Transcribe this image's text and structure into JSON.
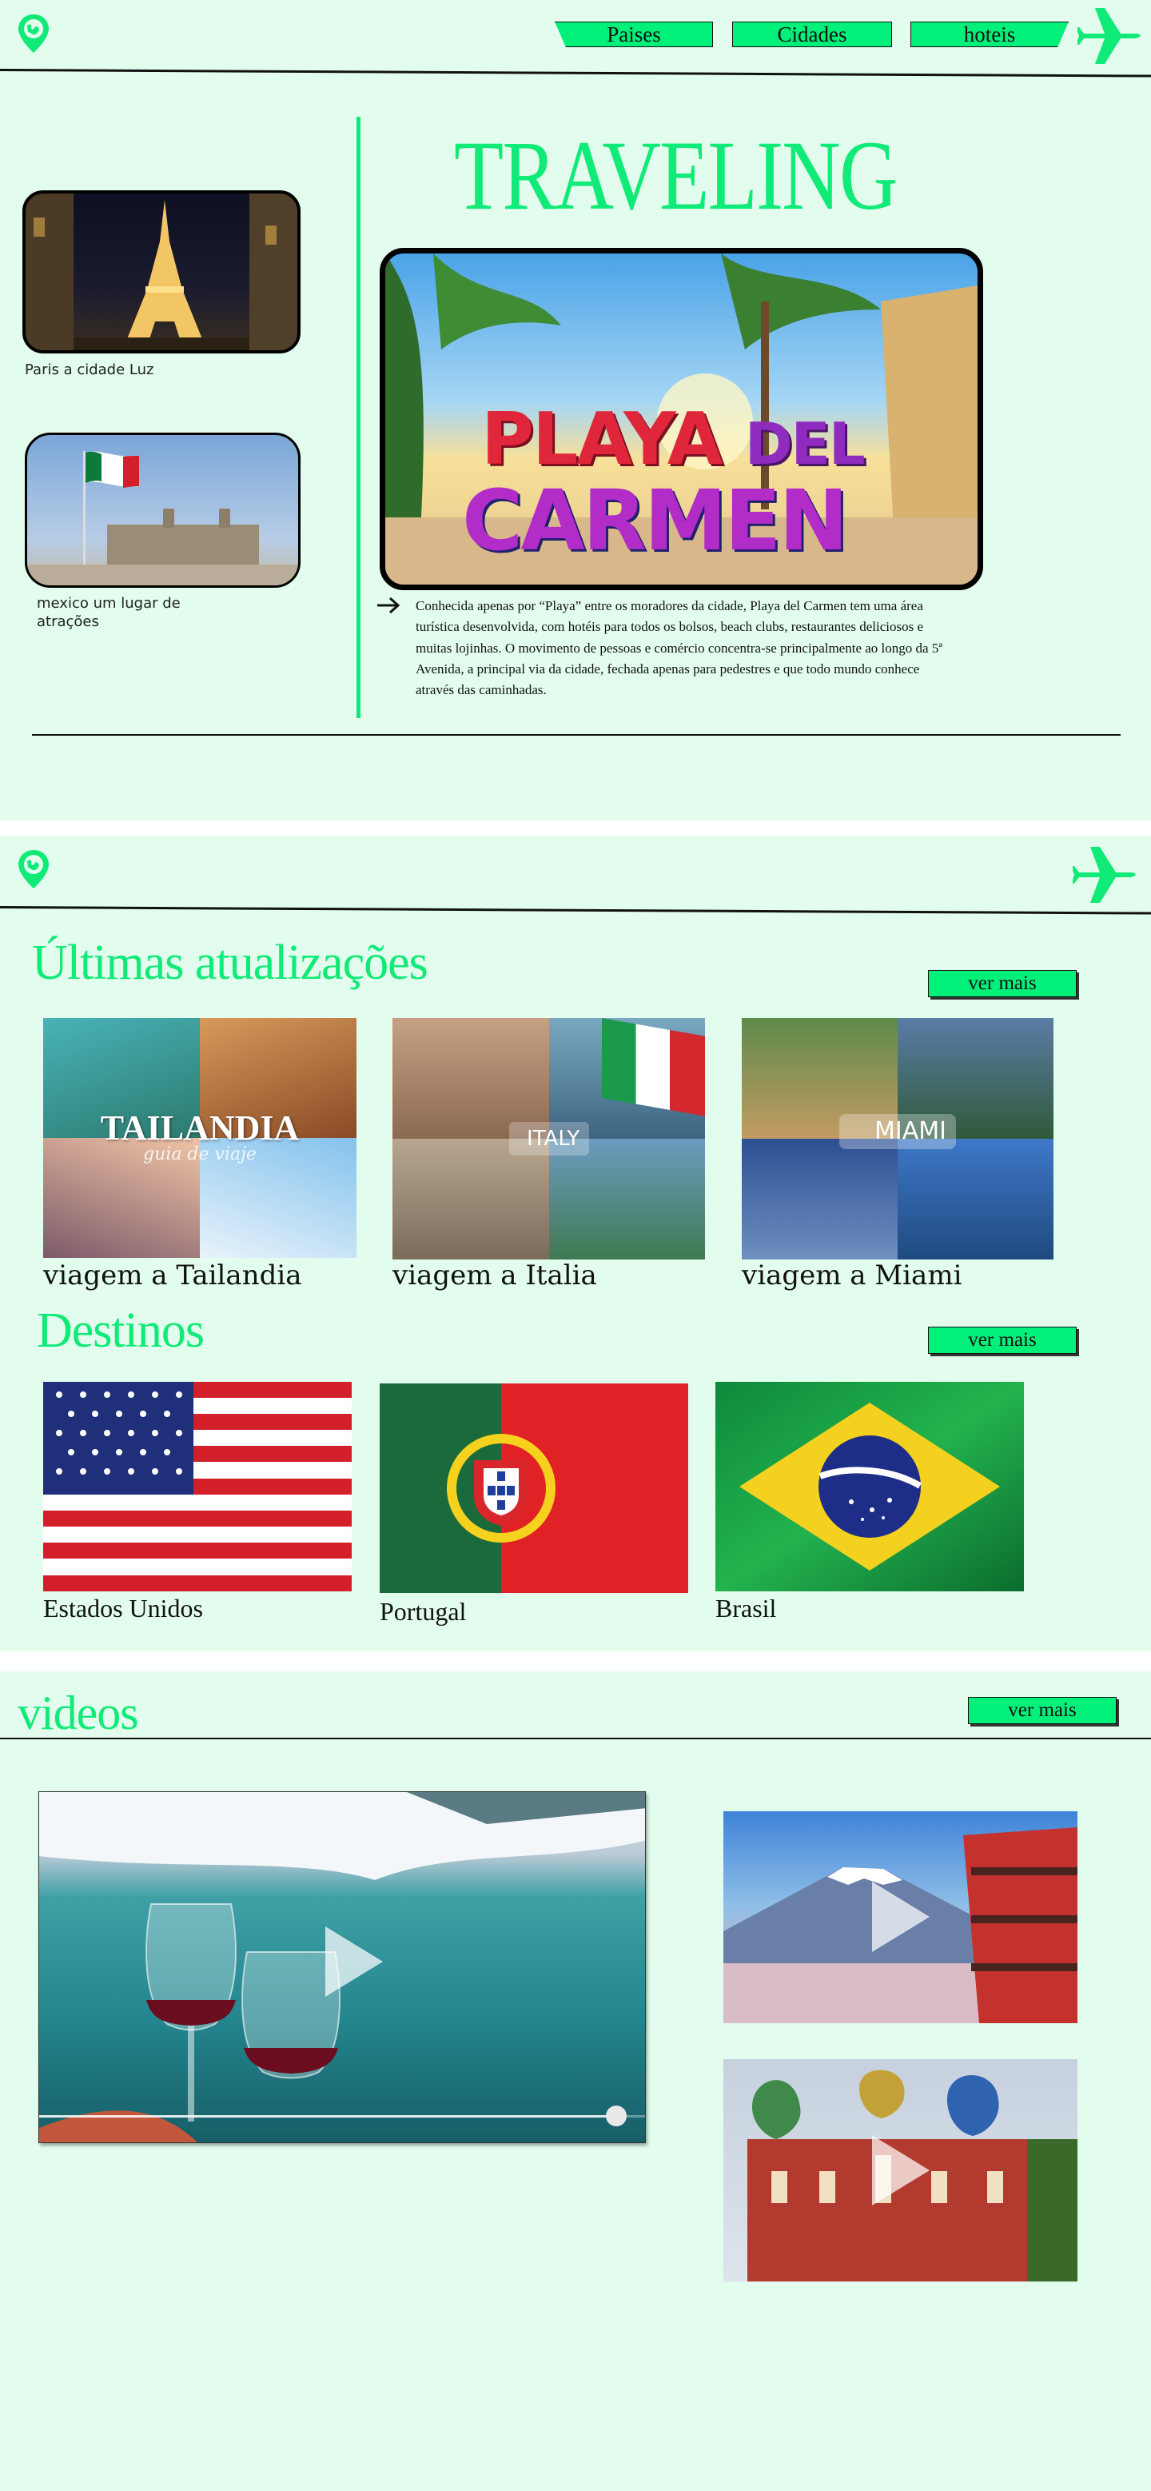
{
  "colors": {
    "accent": "#00f07a",
    "background": "#e2fdee",
    "title_green": "#10ea77"
  },
  "icons": {
    "logo": "globe-pin-icon",
    "plane": "airplane-icon",
    "arrow": "arrow-right-icon",
    "play": "play-icon"
  },
  "nav": {
    "items": [
      "Paises",
      "Cidades",
      "hoteis"
    ]
  },
  "hero": {
    "title": "TRAVELING",
    "left_cards": [
      {
        "caption": "Paris a cidade Luz"
      },
      {
        "caption": "mexico um lugar de atrações"
      }
    ],
    "feature_image_text": {
      "line1": "PLAYA",
      "line2": "DEL",
      "line3": "CARMEN"
    },
    "description": "Conhecida apenas por “Playa” entre os moradores da cidade, Playa del Carmen tem uma área turística desenvolvida, com hotéis para todos os bolsos, beach clubs, restaurantes deliciosos e muitas lojinhas. O movimento de pessoas e comércio concentra-se principalmente ao longo da 5ª Avenida, a principal via da cidade, fechada apenas para pedestres e que todo mundo conhece através das caminhadas."
  },
  "updates": {
    "title": "Últimas atualizações",
    "more_label": "ver mais",
    "cards": [
      {
        "title": "viagem a Tailandia",
        "image_title": "TAILANDIA",
        "image_subtitle": "guia de viaje"
      },
      {
        "title": "viagem a Italia",
        "image_title": "ITALY"
      },
      {
        "title": "viagem a Miami",
        "image_title": "MIAMI"
      }
    ]
  },
  "destinos": {
    "title": "Destinos",
    "more_label": "ver mais",
    "items": [
      {
        "name": "Estados Unidos"
      },
      {
        "name": "Portugal"
      },
      {
        "name": "Brasil"
      }
    ]
  },
  "videos": {
    "title": "videos",
    "more_label": "ver mais",
    "main_progress": 0.95
  }
}
